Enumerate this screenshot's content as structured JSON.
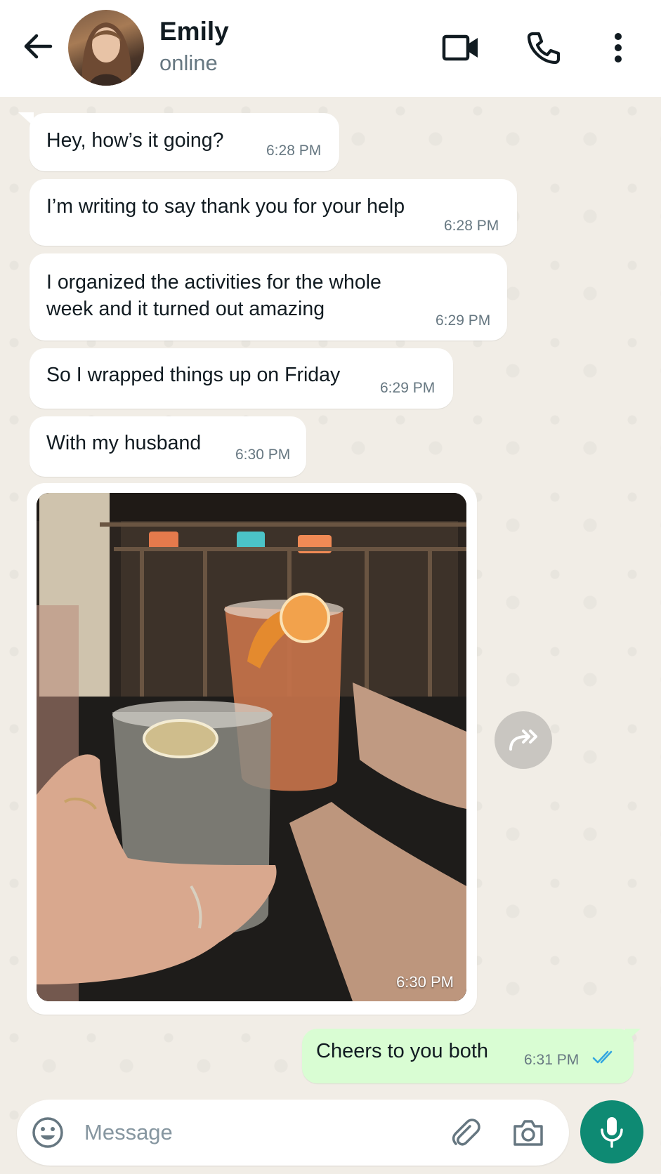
{
  "header": {
    "contact_name": "Emily",
    "contact_status": "online",
    "icons": [
      "back-arrow-icon",
      "video-call-icon",
      "phone-icon",
      "more-vertical-icon"
    ]
  },
  "messages": [
    {
      "direction": "incoming",
      "text": "Hey, how’s it going?",
      "time": "6:28 PM"
    },
    {
      "direction": "incoming",
      "text": "I’m writing to say thank you for your help",
      "time": "6:28 PM"
    },
    {
      "direction": "incoming",
      "text_line1": "I organized the activities for the whole",
      "text_line2": "week and it turned out amazing",
      "time": "6:29 PM"
    },
    {
      "direction": "incoming",
      "text": "So I wrapped things up on Friday",
      "time": "6:29 PM"
    },
    {
      "direction": "incoming",
      "text": "With my husband",
      "time": "6:30 PM"
    },
    {
      "direction": "incoming",
      "type": "photo",
      "time": "6:30 PM"
    },
    {
      "direction": "outgoing",
      "text": "Cheers to you both",
      "time": "6:31 PM",
      "status": "read"
    }
  ],
  "composer": {
    "placeholder": "Message",
    "icons": [
      "emoji-icon",
      "attach-icon",
      "camera-icon",
      "mic-icon"
    ]
  },
  "colors": {
    "accent": "#0e8a73",
    "outgoing_bubble": "#d9fdd3",
    "incoming_bubble": "#ffffff",
    "read_ticks": "#34a7e0"
  }
}
